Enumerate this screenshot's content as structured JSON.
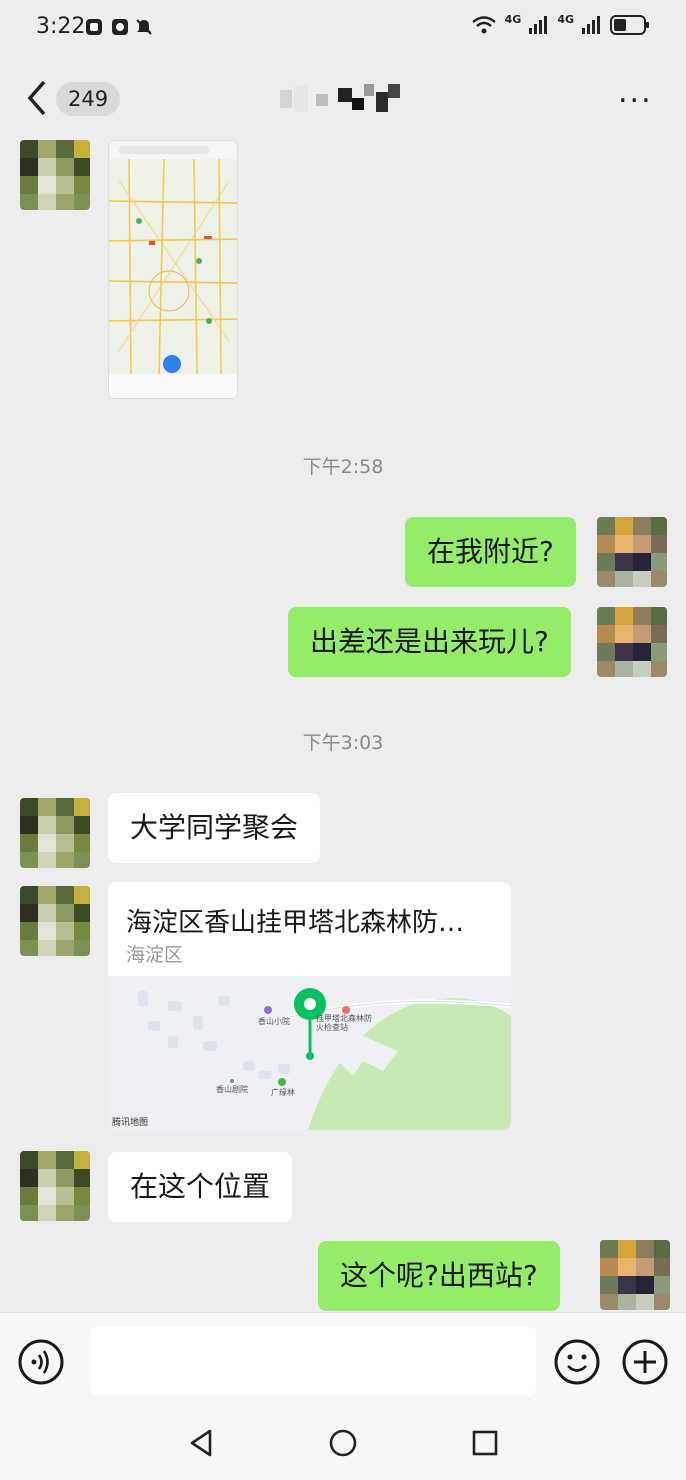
{
  "status": {
    "time": "3:22",
    "network1": "4G",
    "network2": "4G"
  },
  "header": {
    "badge": "249",
    "more_label": "..."
  },
  "timestamps": [
    "下午2:58",
    "下午3:03"
  ],
  "messages": [
    {
      "side": "right",
      "text": "在我附近?"
    },
    {
      "side": "right",
      "text": "出差还是出来玩儿?"
    },
    {
      "side": "left",
      "text": "大学同学聚会"
    },
    {
      "side": "left",
      "text": "在这个位置"
    },
    {
      "side": "right",
      "text": "这个呢?出西站?"
    }
  ],
  "location": {
    "title": "海淀区香山挂甲塔北森林防…",
    "district": "海淀区",
    "map_labels": [
      "香山小院",
      "挂甲塔北森林防火检查站",
      "香山剧院",
      "广缘林"
    ],
    "map_credit": "腾讯地图"
  },
  "colors": {
    "sent_bubble": "#95ec69",
    "recv_bubble": "#ffffff",
    "background": "#ededed",
    "pin": "#07c160"
  }
}
